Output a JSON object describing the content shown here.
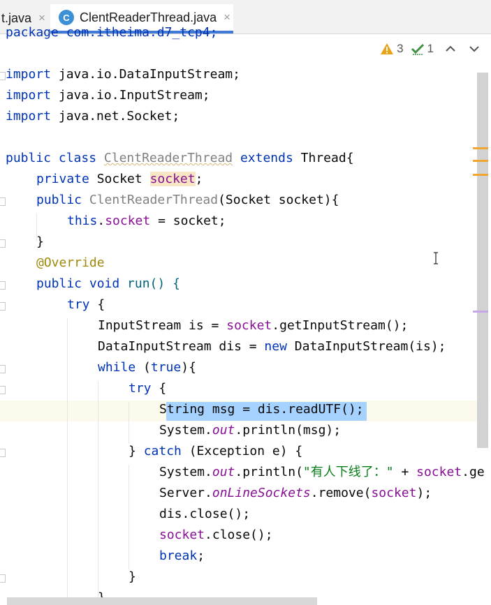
{
  "tabs": [
    {
      "label": "t.java",
      "close": "×"
    },
    {
      "label": "ClentReaderThread.java",
      "badge": "C",
      "close": "×"
    }
  ],
  "inspections": {
    "warnings": "3",
    "ok": "1"
  },
  "colors": {
    "keyword": "#0033b3",
    "field": "#871094",
    "annotation": "#9e880d",
    "string": "#067d17",
    "selection": "#a6d2ff",
    "tab_accent": "#3f7bd6"
  },
  "code": {
    "l0": {
      "a": "package com.itheima.d7_tcp4;"
    },
    "l1": {
      "a": "import",
      "b": " java.io.DataInputStream;"
    },
    "l2": {
      "a": "import",
      "b": " java.io.InputStream;"
    },
    "l3": {
      "a": "import",
      "b": " java.net.Socket;"
    },
    "l5": {
      "a": "public class ",
      "b": "ClentReaderThread",
      "c": " extends ",
      "d": "Thread{"
    },
    "l6": {
      "a": "private ",
      "b": "Socket ",
      "c": "socket",
      "d": ";"
    },
    "l7": {
      "a": "public ",
      "b": "ClentReaderThread",
      "c": "(Socket socket){"
    },
    "l8": {
      "a": "this",
      "b": ".",
      "c": "socket",
      "d": " = socket;"
    },
    "l9": {
      "a": "}"
    },
    "l10": {
      "a": "@Override"
    },
    "l11": {
      "a": "public void ",
      "b": "run() {"
    },
    "l12": {
      "a": "try",
      "b": " {"
    },
    "l13": {
      "a": "InputStream is = ",
      "b": "socket",
      "c": ".getInputStream();"
    },
    "l14": {
      "a": "DataInputStream dis = ",
      "b": "new",
      "c": " DataInputStream(is);"
    },
    "l15": {
      "a": "while",
      "b": " (",
      "c": "true",
      "d": "){"
    },
    "l16": {
      "a": "try",
      "b": " {"
    },
    "l17": {
      "a": "String msg = dis.readUTF();"
    },
    "l18": {
      "a": "System.",
      "b": "out",
      "c": ".println(msg);"
    },
    "l19": {
      "a": "} ",
      "b": "catch",
      "c": " (Exception e) {"
    },
    "l20": {
      "a": "System.",
      "b": "out",
      "c": ".println(",
      "d": "\"有人下线了：\"",
      "e": " + ",
      "f": "socket",
      "g": ".ge"
    },
    "l21": {
      "a": "Server.",
      "b": "onLineSockets",
      "c": ".remove(",
      "d": "socket",
      "e": ");"
    },
    "l22": {
      "a": "dis.close();"
    },
    "l23": {
      "a": "socket",
      "b": ".close();"
    },
    "l24": {
      "a": "break",
      "b": ";"
    },
    "l25": {
      "a": "}"
    },
    "l26": {
      "a": "}"
    }
  }
}
